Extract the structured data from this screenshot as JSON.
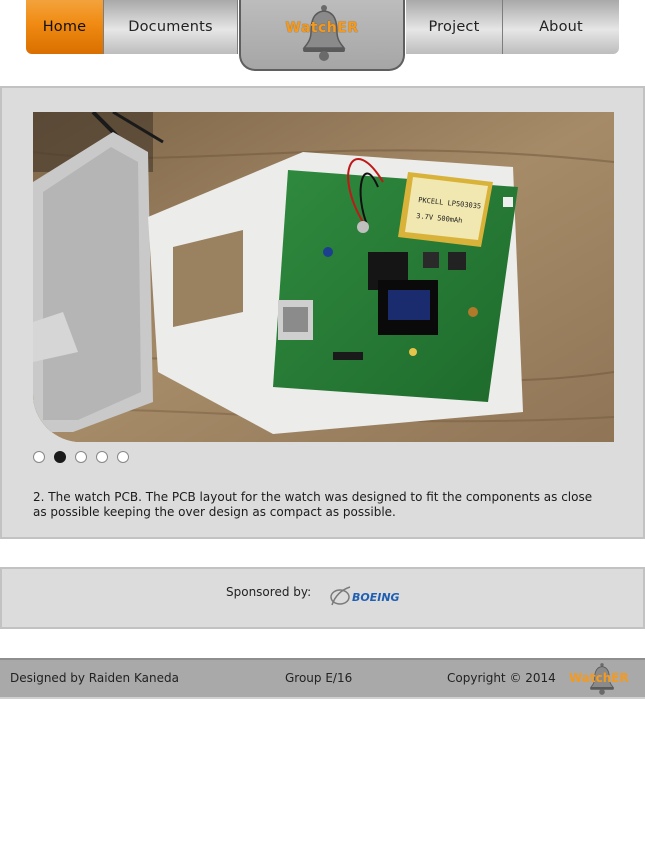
{
  "nav": {
    "items": [
      {
        "label": "Home",
        "active": true
      },
      {
        "label": "Documents",
        "active": false
      },
      {
        "label": "Project",
        "active": false
      },
      {
        "label": "About",
        "active": false
      }
    ],
    "logo_text": "WatchER"
  },
  "slider": {
    "dots": [
      {
        "active": false
      },
      {
        "active": true
      },
      {
        "active": false
      },
      {
        "active": false
      },
      {
        "active": false
      }
    ],
    "caption": "2. The watch PCB. The PCB layout for the watch was designed to fit the components as close as possible keeping the over design as compact as possible.",
    "photo_texts": {
      "battery_line1": "PKCELL LP503035",
      "battery_line2": "3.7V 500mAh"
    }
  },
  "sponsor": {
    "label": "Sponsored by:",
    "logo_text": "BOEING"
  },
  "footer": {
    "designer": "Designed by Raiden Kaneda",
    "group": "Group E/16",
    "copyright": "Copyright © 2014",
    "logo_text": "WatchER"
  },
  "colors": {
    "accent": "#f08a12",
    "panel": "#dcdcdc",
    "footer": "#a9a9a9",
    "boeing_blue": "#1f5fb3"
  }
}
